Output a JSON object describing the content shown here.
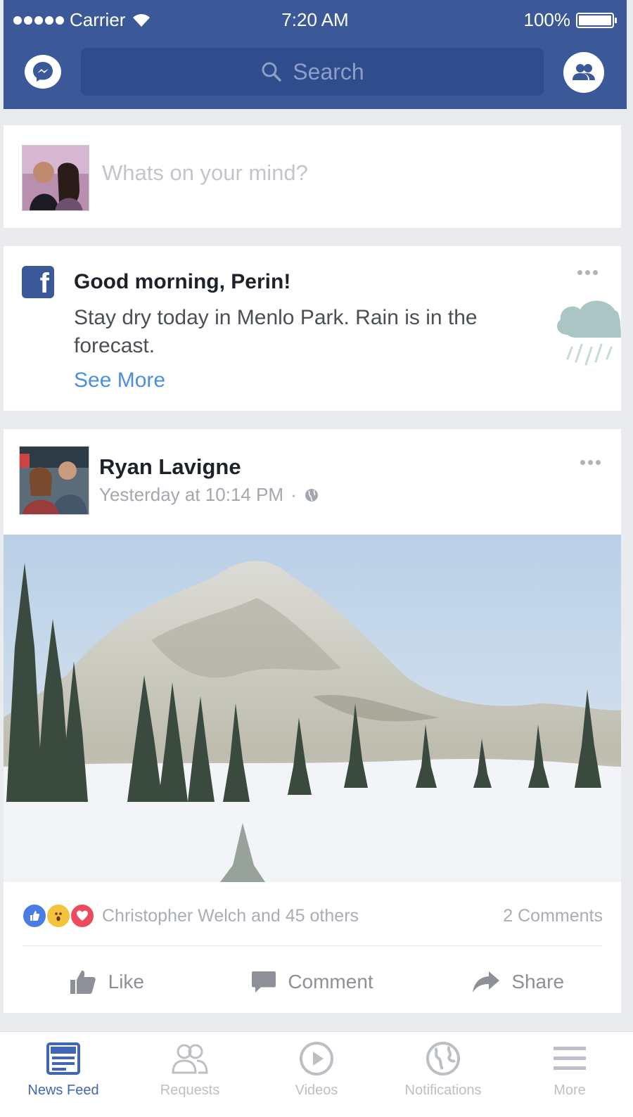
{
  "status_bar": {
    "carrier": "Carrier",
    "time": "7:20 AM",
    "battery": "100%",
    "battery_level": 1.0
  },
  "header": {
    "search_placeholder": "Search",
    "left_icon": "messenger-icon",
    "right_icon": "friend-requests-icon",
    "brand_color": "#3b5998"
  },
  "composer": {
    "placeholder": "Whats on your mind?"
  },
  "greeting_card": {
    "title": "Good morning, Perin!",
    "body": "Stay dry today in Menlo Park. Rain is in the forecast.",
    "link": "See More",
    "icon": "facebook-icon",
    "illustration": "rain-cloud-icon"
  },
  "post": {
    "author": "Ryan Lavigne",
    "timestamp": "Yesterday at 10:14 PM",
    "privacy_icon": "globe-icon",
    "reactions_text": "Christopher Welch and 45 others",
    "comments_text": "2 Comments",
    "reaction_icons": [
      "like-reaction-icon",
      "wow-reaction-icon",
      "love-reaction-icon"
    ],
    "actions": {
      "like": "Like",
      "comment": "Comment",
      "share": "Share"
    }
  },
  "tab_bar": {
    "active_color": "#4267b2",
    "tabs": [
      {
        "label": "News Feed",
        "icon": "news-feed-icon"
      },
      {
        "label": "Requests",
        "icon": "requests-icon"
      },
      {
        "label": "Videos",
        "icon": "videos-icon"
      },
      {
        "label": "Notifications",
        "icon": "notifications-icon"
      },
      {
        "label": "More",
        "icon": "more-menu-icon"
      }
    ]
  }
}
